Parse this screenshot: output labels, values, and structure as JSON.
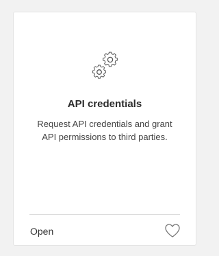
{
  "card": {
    "icon": "gears-icon",
    "title": "API credentials",
    "description_line1": "Request API credentials and grant",
    "description_line2": "API permissions to third parties.",
    "open_label": "Open",
    "favorite_icon": "heart-outline-icon"
  },
  "colors": {
    "background": "#f2f2f2",
    "card": "#ffffff",
    "title": "#2b2b2b",
    "text": "#444444",
    "icon_stroke": "#555555"
  }
}
